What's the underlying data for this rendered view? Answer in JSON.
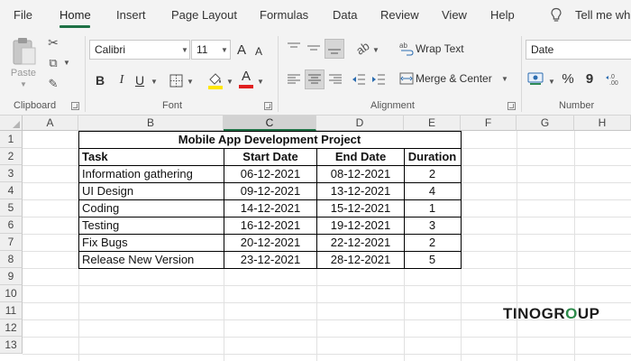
{
  "menu": {
    "tabs": [
      "File",
      "Home",
      "Insert",
      "Page Layout",
      "Formulas",
      "Data",
      "Review",
      "View",
      "Help"
    ],
    "tell_me": "Tell me wh"
  },
  "ribbon": {
    "clipboard": {
      "paste_label": "Paste",
      "group_label": "Clipboard"
    },
    "font": {
      "font_name": "Calibri",
      "font_size": "11",
      "grow_label": "A",
      "shrink_label": "A",
      "bold_label": "B",
      "italic_label": "I",
      "underline_label": "U",
      "font_color_label": "A",
      "group_label": "Font"
    },
    "alignment": {
      "wrap_text": "Wrap Text",
      "merge_center": "Merge & Center",
      "group_label": "Alignment"
    },
    "number": {
      "format": "Date",
      "percent": "%",
      "comma": "9",
      "group_label": "Number"
    }
  },
  "sheet": {
    "columns": [
      "A",
      "B",
      "C",
      "D",
      "E",
      "F",
      "G",
      "H"
    ],
    "selected_column": "C",
    "rows": [
      "1",
      "2",
      "3",
      "4",
      "5",
      "6",
      "7",
      "8",
      "9",
      "10",
      "11",
      "12",
      "13"
    ],
    "title": "Mobile App Development Project",
    "headers": [
      "Task",
      "Start Date",
      "End Date",
      "Duration"
    ],
    "tasks": [
      {
        "task": "Information gathering",
        "start": "06-12-2021",
        "end": "08-12-2021",
        "duration": "2"
      },
      {
        "task": "UI Design",
        "start": "09-12-2021",
        "end": "13-12-2021",
        "duration": "4"
      },
      {
        "task": "Coding",
        "start": "14-12-2021",
        "end": "15-12-2021",
        "duration": "1"
      },
      {
        "task": "Testing",
        "start": "16-12-2021",
        "end": "19-12-2021",
        "duration": "3"
      },
      {
        "task": "Fix Bugs",
        "start": "20-12-2021",
        "end": "22-12-2021",
        "duration": "2"
      },
      {
        "task": "Release New Version",
        "start": "23-12-2021",
        "end": "28-12-2021",
        "duration": "5"
      }
    ]
  },
  "watermark": {
    "part1": "TINO",
    "part2": "GR",
    "part3": "O",
    "part4": "UP"
  },
  "colors": {
    "excel_green": "#1e7145",
    "highlight_yellow": "#ffe600",
    "font_red": "#e02020"
  }
}
